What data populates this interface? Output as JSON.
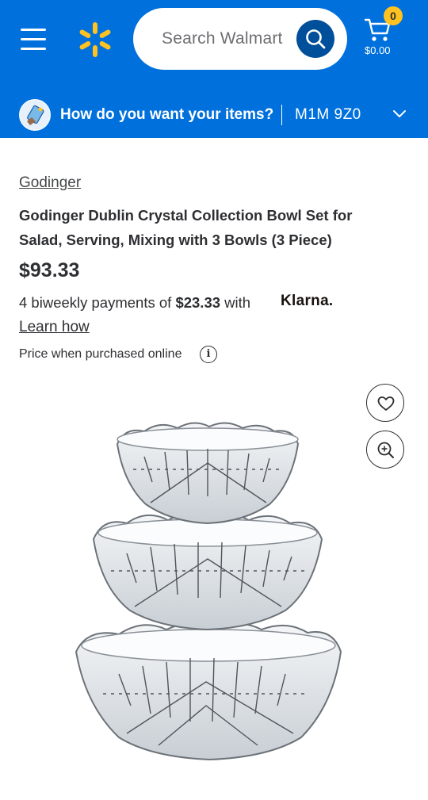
{
  "header": {
    "search_placeholder": "Search Walmart",
    "cart_count": "0",
    "cart_total": "$0.00",
    "brand_color": "#0071dc",
    "spark_color": "#ffc220"
  },
  "fulfillment": {
    "question": "How do you want your items?",
    "postal_code": "M1M 9Z0"
  },
  "product": {
    "brand": "Godinger",
    "title": "Godinger Dublin Crystal Collection Bowl Set for Salad, Serving, Mixing with 3 Bowls (3 Piece)",
    "price": "$93.33",
    "payments_prefix": "4 biweekly payments of ",
    "payments_amount": "$23.33",
    "payments_suffix": " with",
    "klarna_label": "Klarna.",
    "learn_how": "Learn how",
    "price_note": "Price when purchased online"
  },
  "icons": {
    "menu": "menu-icon",
    "spark": "walmart-spark-icon",
    "search": "search-icon",
    "cart": "cart-icon",
    "fulfillment": "fulfillment-icon",
    "chevron": "chevron-down-icon",
    "info": "info-icon",
    "favorite": "heart-icon",
    "zoom": "zoom-in-icon"
  }
}
